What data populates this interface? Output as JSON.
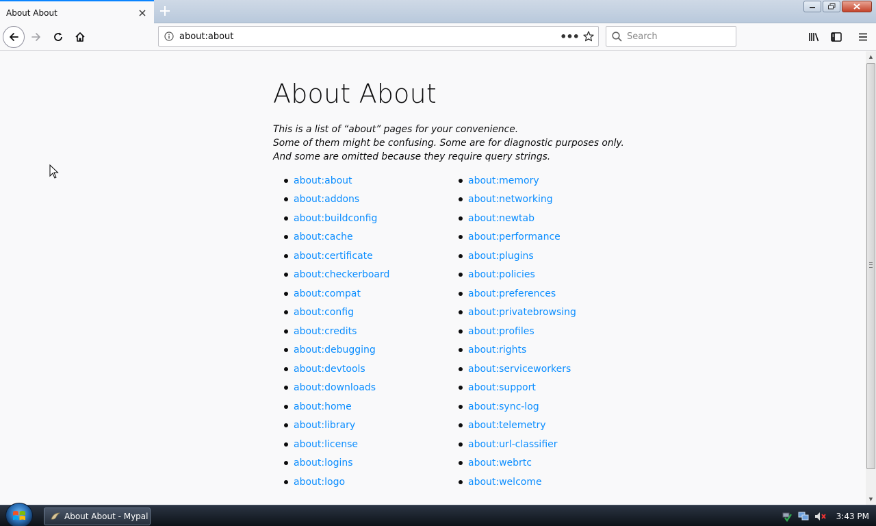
{
  "browser": {
    "tab": {
      "title": "About About"
    },
    "url": "about:about",
    "search": {
      "placeholder": "Search"
    }
  },
  "page": {
    "heading": "About About",
    "intro": [
      "This is a list of “about” pages for your convenience.",
      "Some of them might be confusing. Some are for diagnostic purposes only.",
      "And some are omitted because they require query strings."
    ],
    "links_left": [
      "about:about",
      "about:addons",
      "about:buildconfig",
      "about:cache",
      "about:certificate",
      "about:checkerboard",
      "about:compat",
      "about:config",
      "about:credits",
      "about:debugging",
      "about:devtools",
      "about:downloads",
      "about:home",
      "about:library",
      "about:license",
      "about:logins",
      "about:logo"
    ],
    "links_right": [
      "about:memory",
      "about:networking",
      "about:newtab",
      "about:performance",
      "about:plugins",
      "about:policies",
      "about:preferences",
      "about:privatebrowsing",
      "about:profiles",
      "about:rights",
      "about:serviceworkers",
      "about:support",
      "about:sync-log",
      "about:telemetry",
      "about:url-classifier",
      "about:webrtc",
      "about:welcome"
    ]
  },
  "taskbar": {
    "window_label": "About About - Mypal",
    "clock": "3:43 PM"
  },
  "colors": {
    "link": "#0a8dff",
    "tab_accent": "#0a84ff",
    "background": "#f9f9fa"
  }
}
